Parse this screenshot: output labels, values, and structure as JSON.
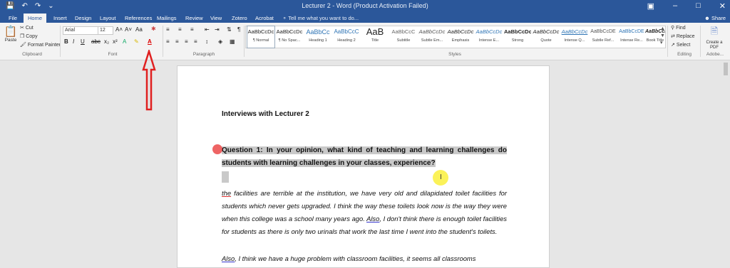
{
  "window": {
    "title": "Lecturer 2 - Word (Product Activation Failed)",
    "share_label": "Share"
  },
  "tabs": [
    "File",
    "Home",
    "Insert",
    "Design",
    "Layout",
    "References",
    "Mailings",
    "Review",
    "View",
    "Zotero",
    "Acrobat"
  ],
  "tell_me": "Tell me what you want to do...",
  "clipboard": {
    "paste": "Paste",
    "cut": "Cut",
    "copy": "Copy",
    "format_painter": "Format Painter",
    "label": "Clipboard"
  },
  "font": {
    "name": "Arial",
    "size": "12",
    "label": "Font"
  },
  "paragraph": {
    "label": "Paragraph"
  },
  "styles": {
    "label": "Styles",
    "items": [
      {
        "preview": "AaBbCcDc",
        "name": "¶ Normal"
      },
      {
        "preview": "AaBbCcDc",
        "name": "¶ No Spac..."
      },
      {
        "preview": "AaBbCc",
        "name": "Heading 1"
      },
      {
        "preview": "AaBbCcC",
        "name": "Heading 2"
      },
      {
        "preview": "AaB",
        "name": "Title"
      },
      {
        "preview": "AaBbCcC",
        "name": "Subtitle"
      },
      {
        "preview": "AaBbCcDc",
        "name": "Subtle Em..."
      },
      {
        "preview": "AaBbCcDc",
        "name": "Emphasis"
      },
      {
        "preview": "AaBbCcDc",
        "name": "Intense E..."
      },
      {
        "preview": "AaBbCcDc",
        "name": "Strong"
      },
      {
        "preview": "AaBbCcDc",
        "name": "Quote"
      },
      {
        "preview": "AaBbCcDc",
        "name": "Intense Q..."
      },
      {
        "preview": "AaBbCcDE",
        "name": "Subtle Ref..."
      },
      {
        "preview": "AaBbCcDE",
        "name": "Intense Re..."
      },
      {
        "preview": "AaBbCcDc",
        "name": "Book Title"
      }
    ]
  },
  "editing": {
    "find": "Find",
    "replace": "Replace",
    "select": "Select",
    "label": "Editing"
  },
  "adobe": {
    "create_pdf": "Create a PDF",
    "label": "Adobe..."
  },
  "document": {
    "heading": "Interviews with Lecturer 2",
    "question": "Question 1: In your opinion, what kind of teaching and learning challenges do students with learning challenges in your classes, experience?",
    "answer1_first": "the",
    "answer1_rest": " facilities are terrible at the institution, we have very old and dilapidated toilet facilities for students which never gets upgraded. I think the way these toilets look now is the way they were when this college was a school many years ago. ",
    "answer1_also": "Also",
    "answer1_end": ", I don't think there is enough toilet facilities for students as there is only two urinals that work the last time I went into the student's toilets.",
    "answer2_also": "Also",
    "answer2_rest": ", I think we have a huge problem with classroom facilities, it seems all classrooms"
  },
  "colors": {
    "brand": "#2b579a",
    "arrow": "#e02020",
    "highlight": "#c9c9c9"
  }
}
